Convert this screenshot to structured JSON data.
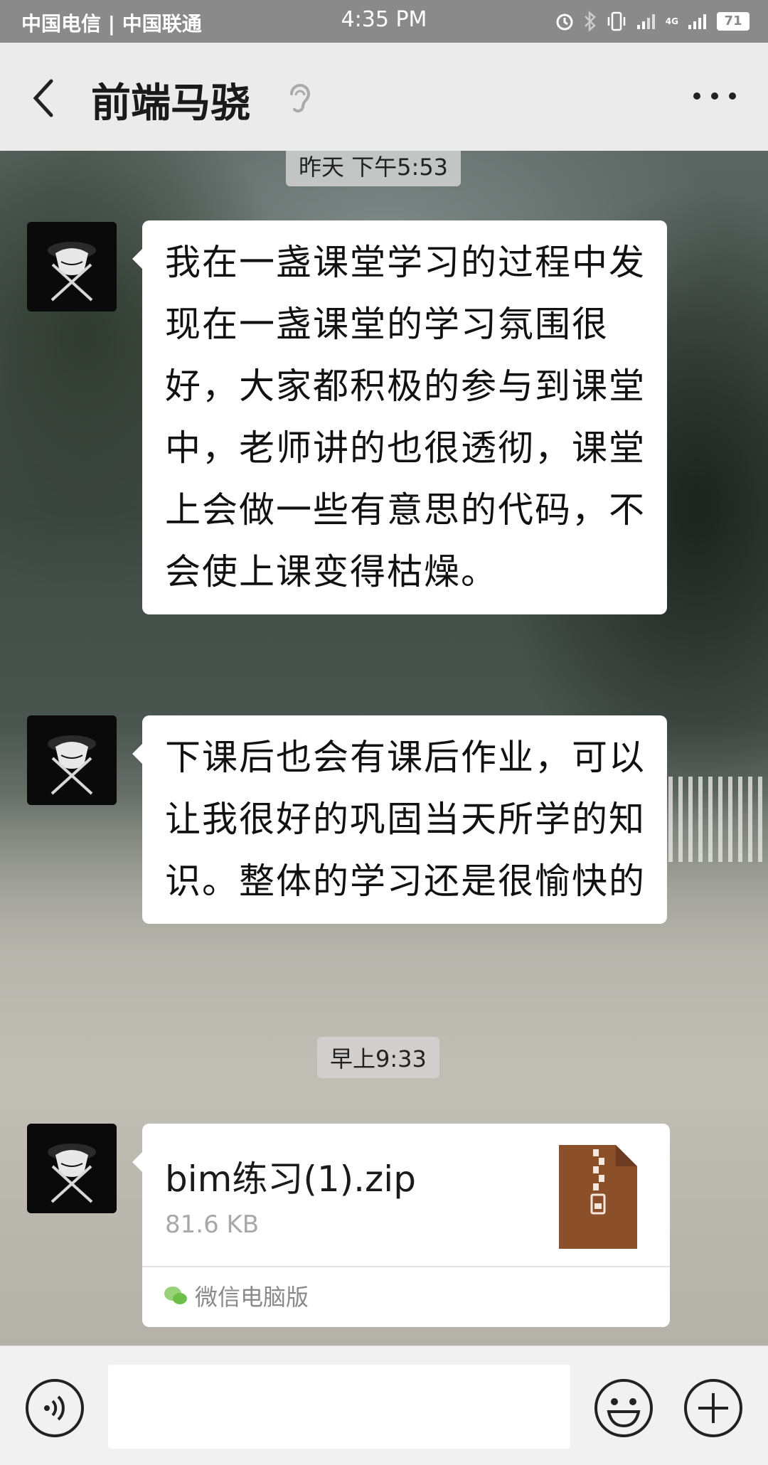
{
  "status_bar": {
    "carrier": "中国电信 | 中国联通",
    "time": "4:35 PM",
    "network": "4G",
    "battery": "71",
    "icons": [
      "alarm-icon",
      "bluetooth-icon",
      "vibrate-icon",
      "signal-icon",
      "signal-icon"
    ]
  },
  "header": {
    "title": "前端马骁",
    "icons": [
      "back-icon",
      "earpiece-icon",
      "more-icon"
    ]
  },
  "chat": {
    "timestamp_1": "昨天 下午5:53",
    "messages": [
      {
        "text": "我在一盏课堂学习的过程中发现在一盏课堂的学习氛围很好，大家都积极的参与到课堂中，老师讲的也很透彻，课堂上会做一些有意思的代码，不会使上课变得枯燥。"
      },
      {
        "text": "下课后也会有课后作业，可以让我很好的巩固当天所学的知识。整体的学习还是很愉快的"
      }
    ],
    "timestamp_2": "早上9:33",
    "file": {
      "name": "bim练习(1).zip",
      "size": "81.6 KB",
      "source": "微信电脑版",
      "icon": "zip-file-icon"
    }
  },
  "input_bar": {
    "placeholder": "",
    "icons": [
      "voice-icon",
      "emoji-icon",
      "plus-icon"
    ]
  },
  "colors": {
    "header_bg": "#ebebeb",
    "statusbar_bg": "#8a8a8a",
    "bubble_bg": "#ffffff",
    "zip_icon": "#8b4f2a"
  }
}
